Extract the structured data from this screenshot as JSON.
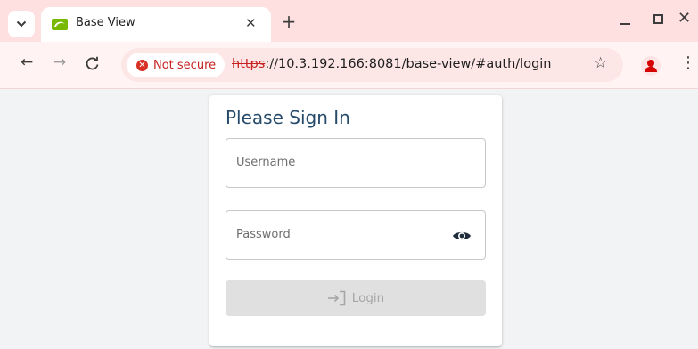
{
  "browser": {
    "tab": {
      "title": "Base View"
    },
    "omnibox": {
      "security_label": "Not secure",
      "url_scheme": "https",
      "url_rest": "://10.3.192.166:8081/base-view/#auth/login"
    }
  },
  "login_card": {
    "title": "Please Sign In",
    "username_placeholder": "Username",
    "password_placeholder": "Password",
    "login_label": "Login"
  },
  "colors": {
    "tabstrip_bg": "#ffe0e1",
    "title_color": "#264a6a",
    "not_secure_red": "#c5221f",
    "button_disabled_bg": "#e0e0e0"
  },
  "icons": {
    "tab_search": "chevron-down-icon",
    "favicon": "nvidia-icon",
    "tab_close": "close-icon",
    "new_tab": "plus-icon",
    "back": "arrow-left-icon",
    "forward": "arrow-right-icon",
    "reload": "reload-icon",
    "security": "warning-icon",
    "bookmark": "star-icon",
    "profile": "profile-icon",
    "menu": "kebab-icon",
    "password_toggle": "eye-icon",
    "login": "sign-in-icon"
  }
}
